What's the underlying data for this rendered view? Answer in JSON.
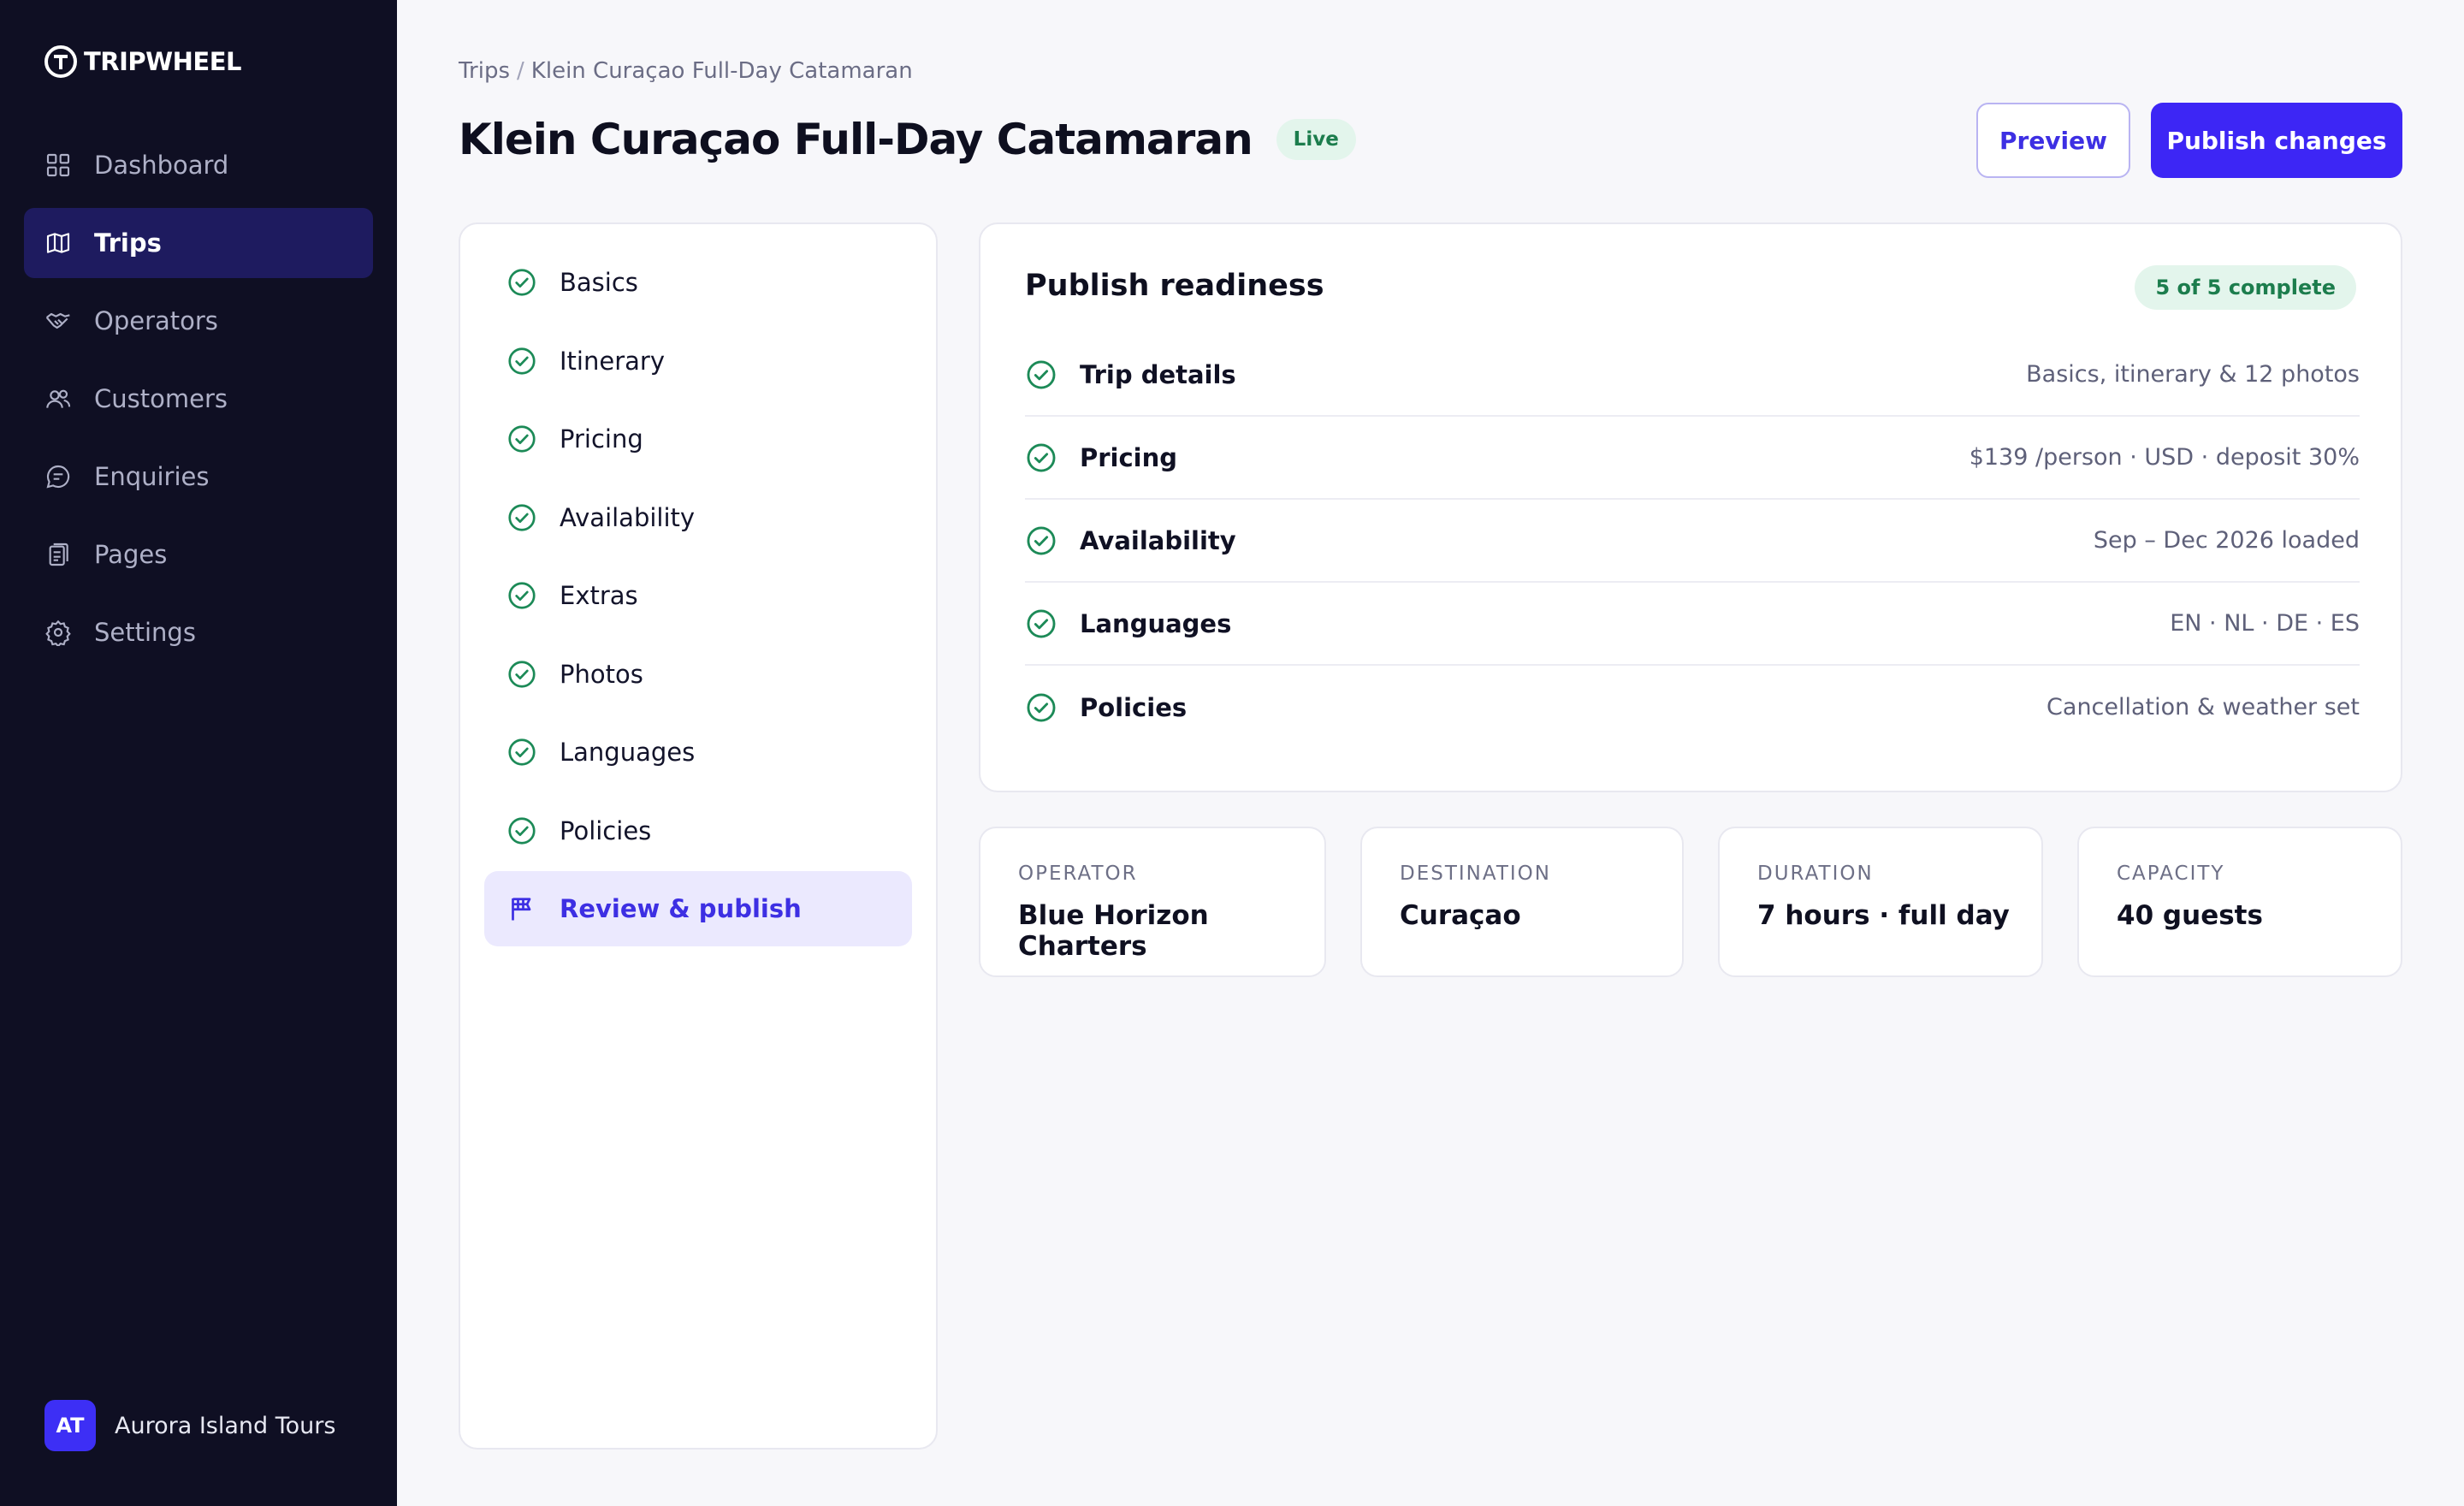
{
  "brand": {
    "name": "TRIPWHEEL"
  },
  "sidebar": {
    "items": [
      {
        "label": "Dashboard",
        "icon": "grid-icon",
        "active": false
      },
      {
        "label": "Trips",
        "icon": "map-icon",
        "active": true
      },
      {
        "label": "Operators",
        "icon": "handshake-icon",
        "active": false
      },
      {
        "label": "Customers",
        "icon": "users-icon",
        "active": false
      },
      {
        "label": "Enquiries",
        "icon": "chat-icon",
        "active": false
      },
      {
        "label": "Pages",
        "icon": "pages-icon",
        "active": false
      },
      {
        "label": "Settings",
        "icon": "gear-icon",
        "active": false
      }
    ],
    "account": {
      "initials": "AT",
      "name": "Aurora Island Tours"
    }
  },
  "breadcrumb": {
    "root": "Trips",
    "separator": "/",
    "current": "Klein Curaçao Full-Day Catamaran"
  },
  "header": {
    "title": "Klein Curaçao Full-Day Catamaran",
    "status": "Live",
    "preview_label": "Preview",
    "publish_label": "Publish changes"
  },
  "steps": [
    {
      "label": "Basics",
      "done": true
    },
    {
      "label": "Itinerary",
      "done": true
    },
    {
      "label": "Pricing",
      "done": true
    },
    {
      "label": "Availability",
      "done": true
    },
    {
      "label": "Extras",
      "done": true
    },
    {
      "label": "Photos",
      "done": true
    },
    {
      "label": "Languages",
      "done": true
    },
    {
      "label": "Policies",
      "done": true
    },
    {
      "label": "Review & publish",
      "done": false,
      "active": true,
      "icon": "flag-icon"
    }
  ],
  "readiness": {
    "title": "Publish readiness",
    "badge": "5 of 5 complete",
    "rows": [
      {
        "label": "Trip details",
        "detail": "Basics, itinerary & 12 photos"
      },
      {
        "label": "Pricing",
        "detail": "$139 /person · USD · deposit 30%"
      },
      {
        "label": "Availability",
        "detail": "Sep – Dec 2026 loaded"
      },
      {
        "label": "Languages",
        "detail": "EN · NL · DE · ES"
      },
      {
        "label": "Policies",
        "detail": "Cancellation & weather set"
      }
    ]
  },
  "info": {
    "operator": {
      "label": "OPERATOR",
      "value": "Blue Horizon Charters"
    },
    "destination": {
      "label": "DESTINATION",
      "value": "Curaçao"
    },
    "duration": {
      "label": "DURATION",
      "value": "7 hours · full day"
    },
    "capacity": {
      "label": "CAPACITY",
      "value": "40 guests"
    }
  },
  "colors": {
    "accent": "#3d26f5",
    "sidebar_bg": "#0f0f23",
    "success": "#1c7d4d"
  }
}
